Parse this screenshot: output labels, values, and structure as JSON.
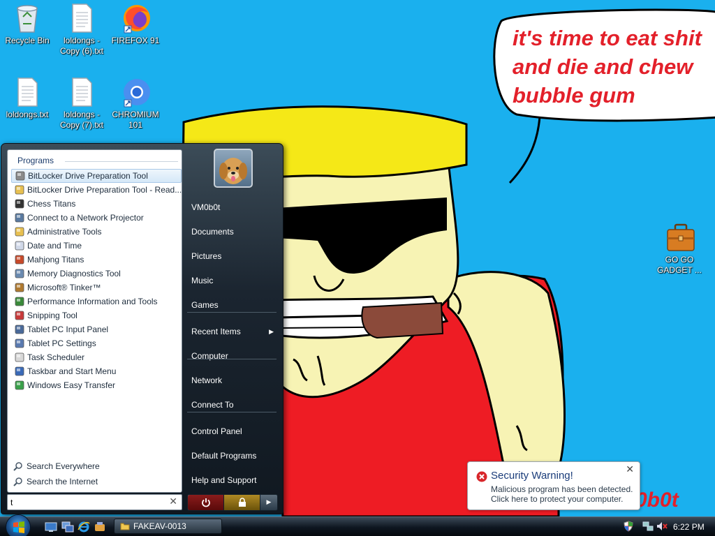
{
  "desktop": {
    "icons": [
      {
        "id": "recycle-bin",
        "label": "Recycle Bin"
      },
      {
        "id": "loldongs-copy-6",
        "label": "loldongs - Copy (6).txt"
      },
      {
        "id": "firefox",
        "label": "FIREFOX 91"
      },
      {
        "id": "loldongs",
        "label": "loldongs.txt"
      },
      {
        "id": "loldongs-copy-7",
        "label": "loldongs - Copy (7).txt"
      },
      {
        "id": "chromium",
        "label": "CHROMIUM 101"
      },
      {
        "id": "go-go-gadget",
        "label": "GO GO GADGET ..."
      }
    ],
    "wallpaper": {
      "speech_line1": "it's time to eat shit",
      "speech_line2": "and die and chew",
      "speech_line3": "bubble gum",
      "signature": "0b0t"
    }
  },
  "start_menu": {
    "programs_header": "Programs",
    "programs": [
      {
        "label": "BitLocker Drive Preparation Tool",
        "icon": "bitlocker-icon",
        "selected": true
      },
      {
        "label": "BitLocker Drive Preparation Tool - Read...",
        "icon": "folder-icon"
      },
      {
        "label": "Chess Titans",
        "icon": "chess-icon"
      },
      {
        "label": "Connect to a Network Projector",
        "icon": "projector-icon"
      },
      {
        "label": "Administrative Tools",
        "icon": "folder-icon"
      },
      {
        "label": "Date and Time",
        "icon": "calendar-icon"
      },
      {
        "label": "Mahjong Titans",
        "icon": "mahjong-icon"
      },
      {
        "label": "Memory Diagnostics Tool",
        "icon": "memory-icon"
      },
      {
        "label": "Microsoft® Tinker™",
        "icon": "tinker-icon"
      },
      {
        "label": "Performance Information and Tools",
        "icon": "performance-icon"
      },
      {
        "label": "Snipping Tool",
        "icon": "scissors-icon"
      },
      {
        "label": "Tablet PC Input Panel",
        "icon": "tablet-icon"
      },
      {
        "label": "Tablet PC Settings",
        "icon": "tablet-settings-icon"
      },
      {
        "label": "Task Scheduler",
        "icon": "clock-icon"
      },
      {
        "label": "Taskbar and Start Menu",
        "icon": "taskbar-icon"
      },
      {
        "label": "Windows Easy Transfer",
        "icon": "transfer-icon"
      }
    ],
    "search_everywhere": "Search Everywhere",
    "search_internet": "Search the Internet",
    "search": {
      "value": "t",
      "clear": "✕"
    },
    "right_items": [
      {
        "label": "VM0b0t",
        "submenu": false
      },
      {
        "label": "Documents",
        "submenu": false
      },
      {
        "label": "Pictures",
        "submenu": false
      },
      {
        "label": "Music",
        "submenu": false
      },
      {
        "label": "Games",
        "submenu": false
      },
      {
        "label": "Recent Items",
        "submenu": true
      },
      {
        "label": "Computer",
        "submenu": false
      },
      {
        "label": "Network",
        "submenu": false
      },
      {
        "label": "Connect To",
        "submenu": false
      },
      {
        "label": "Control Panel",
        "submenu": false
      },
      {
        "label": "Default Programs",
        "submenu": false
      },
      {
        "label": "Help and Support",
        "submenu": false
      }
    ],
    "submenu_arrow": "▶",
    "power_options_arrow": "▶"
  },
  "notification": {
    "title": "Security Warning!",
    "line1": "Malicious program has been detected.",
    "line2": "Click here to protect your computer.",
    "close": "✕"
  },
  "taskbar": {
    "window_button": "FAKEAV-0013",
    "clock": "6:22 PM"
  },
  "colors": {
    "wallpaper_blue": "#1ab0ee",
    "speech_red": "#e3202a",
    "hat_yellow": "#f5e817",
    "shirt_red": "#ee1c24",
    "skin": "#f7f3b4"
  }
}
